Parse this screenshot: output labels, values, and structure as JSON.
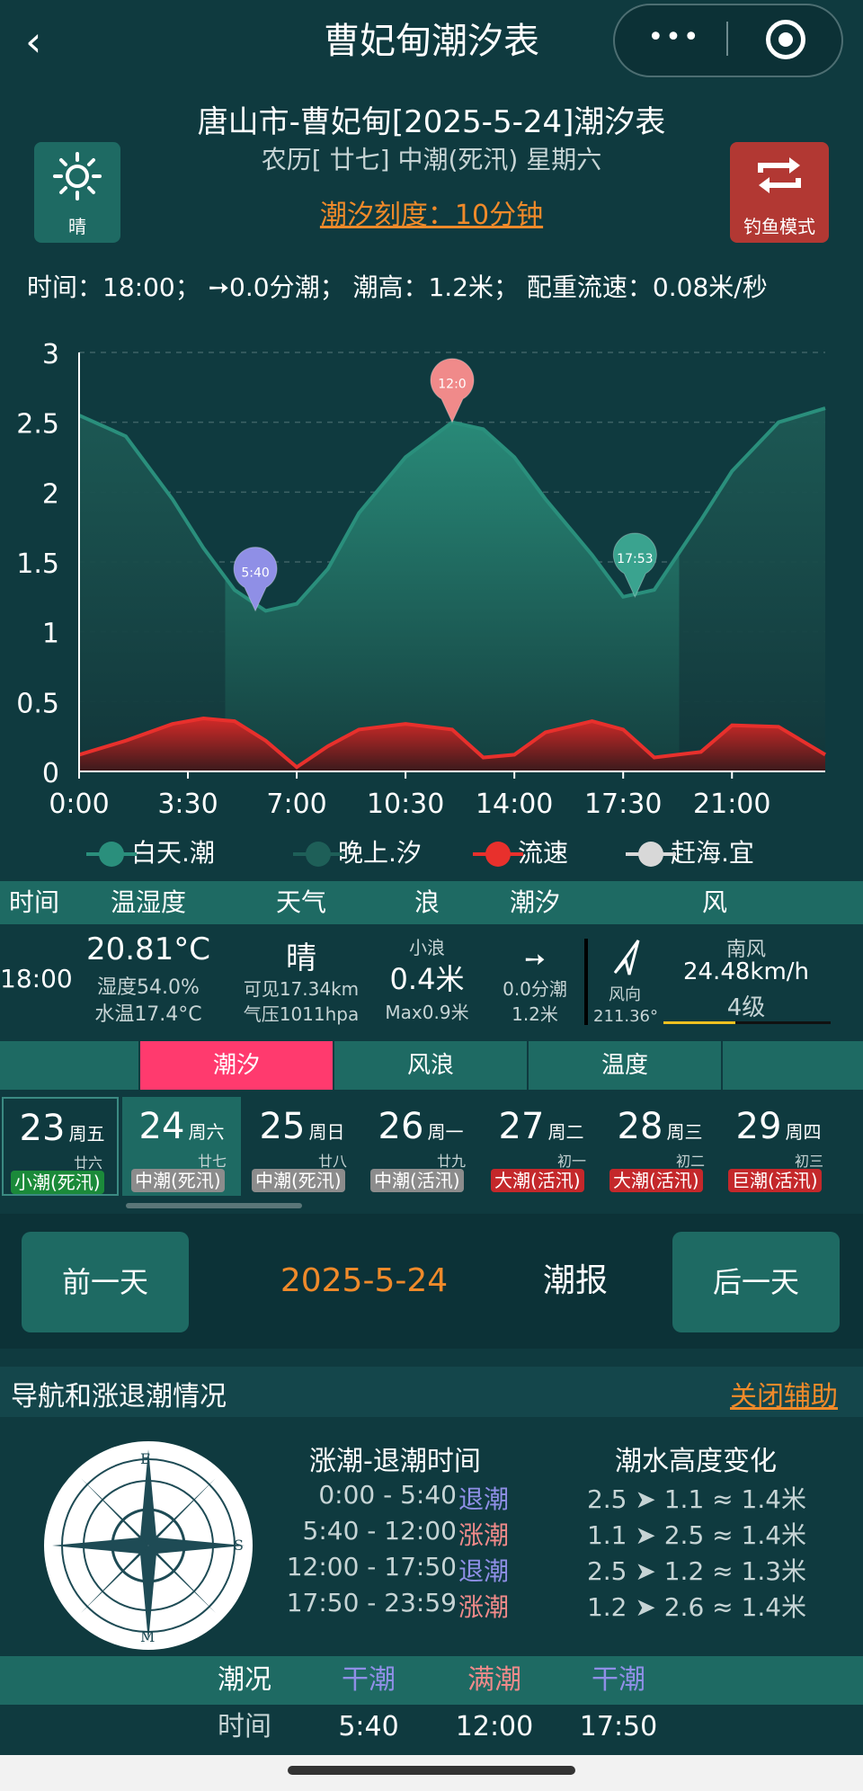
{
  "header": {
    "back_icon": "chevron-left-icon",
    "title": "曹妃甸潮汐表",
    "more_icon": "more-dots-icon",
    "close_icon": "target-icon"
  },
  "subtitle": "唐山市-曹妃甸[2025-5-24]潮汐表",
  "lunar_line": "农历[ 廿七] 中潮(死汛) 星期六",
  "scale_link": "潮汐刻度：10分钟",
  "weather_tile": {
    "icon": "sun-icon",
    "label": "晴"
  },
  "fishing_tile": {
    "icon": "repeat-icon",
    "label": "钓鱼模式"
  },
  "info_line": "时间：18:00； ➙0.0分潮； 潮高：1.2米； 配重流速：0.08米/秒",
  "chart_data": {
    "type": "area",
    "x": [
      0,
      1.5,
      3,
      4,
      5,
      6,
      7,
      8,
      9,
      10.5,
      12,
      13,
      14,
      15,
      16.5,
      17.5,
      18.5,
      20,
      21,
      22.5,
      24
    ],
    "x_ticks": [
      "0:00",
      "3:30",
      "7:00",
      "10:30",
      "14:00",
      "17:30",
      "21:00"
    ],
    "x_tick_hours": [
      0,
      3.5,
      7,
      10.5,
      14,
      17.5,
      21
    ],
    "ylim": [
      0,
      3
    ],
    "y_ticks": [
      "0",
      "0.5",
      "1",
      "1.5",
      "2",
      "2.5",
      "3"
    ],
    "day_span": [
      4.7,
      19.3
    ],
    "series": [
      {
        "name": "白天.潮",
        "color": "#2a8f7c",
        "values": [
          2.55,
          2.4,
          1.95,
          1.6,
          1.3,
          1.15,
          1.2,
          1.45,
          1.85,
          2.25,
          2.5,
          2.45,
          2.25,
          1.95,
          1.55,
          1.25,
          1.3,
          1.8,
          2.15,
          2.5,
          2.6
        ]
      },
      {
        "name": "流速",
        "color": "#e8302c",
        "values": [
          0.12,
          0.22,
          0.34,
          0.38,
          0.36,
          0.22,
          0.03,
          0.18,
          0.3,
          0.34,
          0.3,
          0.1,
          0.12,
          0.28,
          0.36,
          0.3,
          0.1,
          0.14,
          0.33,
          0.32,
          0.12
        ]
      }
    ],
    "markers": [
      {
        "label": "5:40",
        "hour": 5.67,
        "value": 1.15,
        "color": "#8f8fe6"
      },
      {
        "label": "12:0",
        "hour": 12,
        "value": 2.5,
        "color": "#f08a8a"
      },
      {
        "label": "17:53",
        "hour": 17.88,
        "value": 1.25,
        "color": "#3aa38f"
      }
    ],
    "legend": [
      {
        "label": "白天.潮",
        "color": "#2a8f7c"
      },
      {
        "label": "晚上.汐",
        "color": "#1e5f58"
      },
      {
        "label": "流速",
        "color": "#e8302c"
      },
      {
        "label": "赶海.宜",
        "color": "#d8d8d8"
      }
    ]
  },
  "table": {
    "headers": [
      "时间",
      "温湿度",
      "天气",
      "浪",
      "潮汐",
      "风"
    ],
    "time": "18:00",
    "temp": "20.81°C",
    "humidity": "湿度54.0%",
    "water_temp": "水温17.4°C",
    "weather": "晴",
    "visibility": "可见17.34km",
    "pressure": "气压1011hpa",
    "wave_label": "小浪",
    "wave_height": "0.4米",
    "wave_max": "Max0.9米",
    "tide_arrow": "➙",
    "tide_rate": "0.0分潮",
    "tide_height": "1.2米",
    "wind_dir_label": "风向",
    "wind_deg": "211.36°",
    "wind_name": "南风",
    "wind_speed": "24.48km/h",
    "wind_level": "4级"
  },
  "tabs": [
    "潮汐",
    "风浪",
    "温度"
  ],
  "days": [
    {
      "day": "23",
      "week": "周五",
      "lunar": "廿六",
      "badge": "小潮(死汛)",
      "color": "#1b8a3a"
    },
    {
      "day": "24",
      "week": "周六",
      "lunar": "廿七",
      "badge": "中潮(死汛)",
      "color": "#8c8c8c"
    },
    {
      "day": "25",
      "week": "周日",
      "lunar": "廿八",
      "badge": "中潮(死汛)",
      "color": "#8c8c8c"
    },
    {
      "day": "26",
      "week": "周一",
      "lunar": "廿九",
      "badge": "中潮(活汛)",
      "color": "#8c8c8c"
    },
    {
      "day": "27",
      "week": "周二",
      "lunar": "初一",
      "badge": "大潮(活汛)",
      "color": "#c4282b"
    },
    {
      "day": "28",
      "week": "周三",
      "lunar": "初二",
      "badge": "大潮(活汛)",
      "color": "#c4282b"
    },
    {
      "day": "29",
      "week": "周四",
      "lunar": "初三",
      "badge": "巨潮(活汛)",
      "color": "#c4282b"
    }
  ],
  "nav": {
    "prev": "前一天",
    "date": "2025-5-24",
    "report": "潮报",
    "next": "后一天"
  },
  "section": {
    "title": "导航和涨退潮情况",
    "close": "关闭辅助"
  },
  "compass_icon": "compass-icon",
  "rise_fall": {
    "title": "涨潮-退潮时间",
    "rows": [
      {
        "range": "0:00 - 5:40",
        "state": "退潮",
        "color": "#8f8fe6"
      },
      {
        "range": "5:40 - 12:00",
        "state": "涨潮",
        "color": "#f08a8a"
      },
      {
        "range": "12:00 - 17:50",
        "state": "退潮",
        "color": "#8f8fe6"
      },
      {
        "range": "17:50 - 23:59",
        "state": "涨潮",
        "color": "#f08a8a"
      }
    ]
  },
  "height_change": {
    "title": "潮水高度变化",
    "rows": [
      "2.5 ➤ 1.1 ≈ 1.4米",
      "1.1 ➤ 2.5 ≈ 1.4米",
      "2.5 ➤ 1.2 ≈ 1.3米",
      "1.2 ➤ 2.6 ≈ 1.4米"
    ]
  },
  "summary": {
    "head": [
      "潮况",
      "干潮",
      "满潮",
      "干潮"
    ],
    "head_colors": [
      "#ffffff",
      "#8f8fe6",
      "#f08a8a",
      "#8f8fe6"
    ],
    "row": [
      "时间",
      "5:40",
      "12:00",
      "17:50"
    ]
  }
}
